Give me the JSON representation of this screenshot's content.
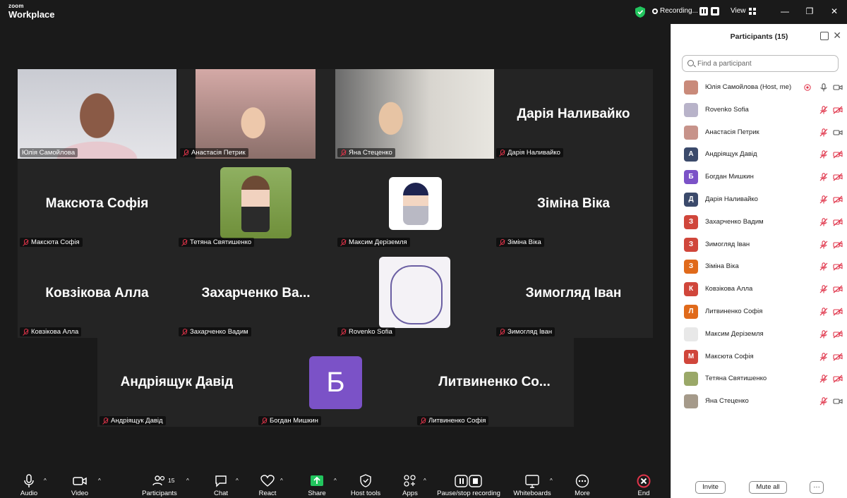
{
  "app": {
    "logo_small": "zoom",
    "logo_big": "Workplace",
    "recording_label": "Recording...",
    "view_label": "View"
  },
  "window_controls": {
    "minimize": "—",
    "restore": "❐",
    "close": "✕"
  },
  "tiles": [
    {
      "name": "Юлія Самойлова",
      "label": "Юлія Самойлова",
      "kind": "video",
      "active": true
    },
    {
      "name": "Анастасія Петрик",
      "label": "Анастасія Петрик",
      "kind": "video"
    },
    {
      "name": "Яна Стеценко",
      "label": "Яна Стеценко",
      "kind": "video"
    },
    {
      "name": "Дарія Наливайко",
      "label": "Дарія Наливайко",
      "kind": "name"
    },
    {
      "name": "Максюта Софія",
      "label": "Максюта Софія",
      "kind": "name"
    },
    {
      "name": "Тетяна Святишенко",
      "label": "Тетяна Святишенко",
      "kind": "thumb"
    },
    {
      "name": "Максим Деріземля",
      "label": "Максим Деріземля",
      "kind": "thumb"
    },
    {
      "name": "Зіміна Віка",
      "label": "Зіміна Віка",
      "kind": "name"
    },
    {
      "name": "Ковзікова Алла",
      "label": "Ковзікова Алла",
      "kind": "name"
    },
    {
      "name": "Захарченко Ва...",
      "label": "Захарченко Вадим",
      "kind": "name"
    },
    {
      "name": "Rovenko Sofia",
      "label": "Rovenko Sofia",
      "kind": "thumb"
    },
    {
      "name": "Зимогляд Іван",
      "label": "Зимогляд Іван",
      "kind": "name"
    },
    {
      "name": "Андріящук Давід",
      "label": "Андріящук Давід",
      "kind": "name"
    },
    {
      "name": "Б",
      "label": "Богдан Мишкин",
      "kind": "avatar"
    },
    {
      "name": "Литвиненко Со...",
      "label": "Литвиненко Софія",
      "kind": "name"
    }
  ],
  "toolbar": {
    "audio": "Audio",
    "video": "Video",
    "participants": "Participants",
    "participants_count": "15",
    "chat": "Chat",
    "react": "React",
    "share": "Share",
    "host_tools": "Host tools",
    "apps": "Apps",
    "recording": "Pause/stop recording",
    "whiteboards": "Whiteboards",
    "more": "More",
    "end": "End"
  },
  "panel": {
    "title": "Participants (15)",
    "search_placeholder": "Find a participant",
    "invite": "Invite",
    "mute_all": "Mute all",
    "more": "···",
    "participants": [
      {
        "name": "Юлія Самойлова (Host, me)",
        "avatar": "",
        "color": "#c98a7a",
        "mic": "on",
        "cam": "on",
        "host": true
      },
      {
        "name": "Rovenko Sofia",
        "avatar": "",
        "color": "#b8b3c9",
        "mic": "off",
        "cam": "off"
      },
      {
        "name": "Анастасія Петрик",
        "avatar": "",
        "color": "#c7938a",
        "mic": "off",
        "cam": "on"
      },
      {
        "name": "Андріящук Давід",
        "avatar": "А",
        "color": "#3b4a6b",
        "mic": "off",
        "cam": "off"
      },
      {
        "name": "Богдан Мишкин",
        "avatar": "Б",
        "color": "#7b52c7",
        "mic": "off",
        "cam": "off"
      },
      {
        "name": "Дарія Наливайко",
        "avatar": "Д",
        "color": "#3b4a6b",
        "mic": "off",
        "cam": "off"
      },
      {
        "name": "Захарченко Вадим",
        "avatar": "З",
        "color": "#d0463b",
        "mic": "off",
        "cam": "off"
      },
      {
        "name": "Зимогляд Іван",
        "avatar": "З",
        "color": "#d0463b",
        "mic": "off",
        "cam": "off"
      },
      {
        "name": "Зіміна Віка",
        "avatar": "З",
        "color": "#e06a1b",
        "mic": "off",
        "cam": "off"
      },
      {
        "name": "Ковзікова Алла",
        "avatar": "К",
        "color": "#d0463b",
        "mic": "off",
        "cam": "off"
      },
      {
        "name": "Литвиненко Софія",
        "avatar": "Л",
        "color": "#e06a1b",
        "mic": "off",
        "cam": "off"
      },
      {
        "name": "Максим Деріземля",
        "avatar": "",
        "color": "#e8e8e8",
        "mic": "off",
        "cam": "off"
      },
      {
        "name": "Максюта Софія",
        "avatar": "М",
        "color": "#d0463b",
        "mic": "off",
        "cam": "off"
      },
      {
        "name": "Тетяна Святишенко",
        "avatar": "",
        "color": "#9aa868",
        "mic": "off",
        "cam": "off"
      },
      {
        "name": "Яна Стеценко",
        "avatar": "",
        "color": "#a59a8a",
        "mic": "off",
        "cam": "on"
      }
    ]
  },
  "colors": {
    "accent_green": "#22c55e",
    "muted_red": "#e0344a",
    "share_green": "#22c55e",
    "end_red": "#e0344a"
  }
}
